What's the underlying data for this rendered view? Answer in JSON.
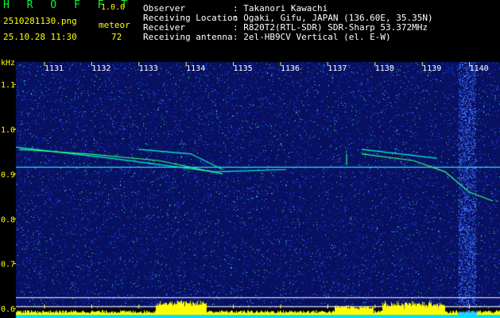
{
  "header": {
    "app_name": "H R O F F T",
    "version": "1.0.0",
    "filename": "2510281130.png",
    "datetime": "25.10.28 11:30",
    "meteor_label": "meteor",
    "meteor_count": "72",
    "info": [
      {
        "label": "Observer",
        "value": ": Takanori Kawachi"
      },
      {
        "label": "Receiving Location",
        "value": ": Ogaki, Gifu, JAPAN (136.60E, 35.35N)"
      },
      {
        "label": "Receiver",
        "value": ": R820T2(RTL-SDR) SDR-Sharp 53.372MHz"
      },
      {
        "label": "Receiving antenna",
        "value": ": 2el-HB9CV Vertical (el. E-W)"
      }
    ]
  },
  "axis": {
    "unit": "kHz",
    "y_ticks": [
      "1.1",
      "1.0",
      "0.9",
      "0.8",
      "0.7",
      "0.6"
    ],
    "x_ticks": [
      "1131",
      "1132",
      "1133",
      "1134",
      "1135",
      "1136",
      "1137",
      "1138",
      "1139",
      "1140"
    ]
  },
  "colors": {
    "background": "#000000",
    "noise_blue": "#1a3cff",
    "signal_cyan": "#00ffff",
    "signal_green": "#33ff66",
    "axis_text": "#ffff00",
    "bottom_bar": "#ffff00"
  }
}
